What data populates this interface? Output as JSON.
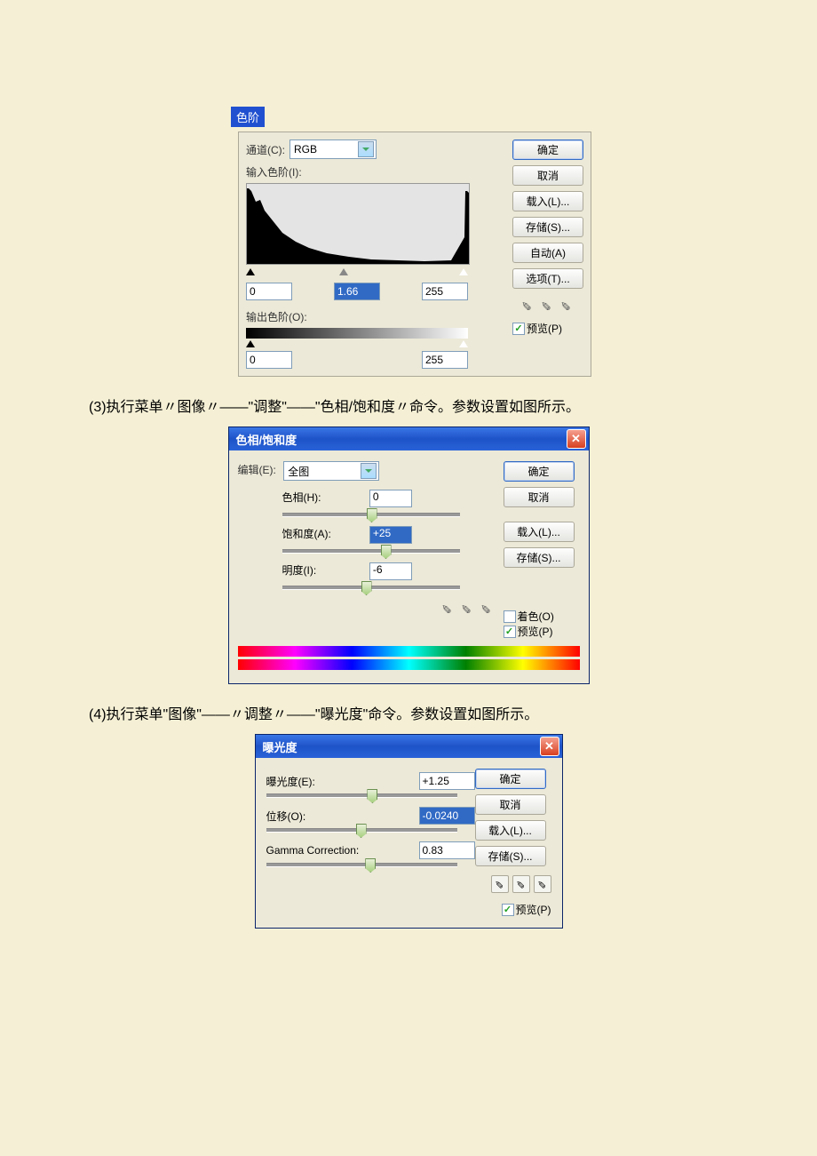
{
  "levels": {
    "title": "色阶",
    "channel_label": "通道(C):",
    "channel_value": "RGB",
    "input_label": "输入色阶(I):",
    "output_label": "输出色阶(O):",
    "in_low": "0",
    "in_mid": "1.66",
    "in_high": "255",
    "out_low": "0",
    "out_high": "255",
    "buttons": {
      "ok": "确定",
      "cancel": "取消",
      "load": "载入(L)...",
      "save": "存储(S)...",
      "auto": "自动(A)",
      "options": "选项(T)..."
    },
    "preview_label": "预览(P)"
  },
  "instruction3": "(3)执行菜单〃图像〃——\"调整\"——\"色相/饱和度〃命令。参数设置如图所示。",
  "huesat": {
    "title": "色相/饱和度",
    "edit_label": "编辑(E):",
    "edit_value": "全图",
    "hue_label": "色相(H):",
    "hue_value": "0",
    "sat_label": "饱和度(A):",
    "sat_value": "+25",
    "light_label": "明度(I):",
    "light_value": "-6",
    "buttons": {
      "ok": "确定",
      "cancel": "取消",
      "load": "载入(L)...",
      "save": "存储(S)..."
    },
    "colorize_label": "着色(O)",
    "preview_label": "预览(P)"
  },
  "instruction4": "(4)执行菜单\"图像\"——〃调整〃——\"曝光度\"命令。参数设置如图所示。",
  "exposure": {
    "title": "曝光度",
    "exposure_label": "曝光度(E):",
    "exposure_value": "+1.25",
    "offset_label": "位移(O):",
    "offset_value": "-0.0240",
    "gamma_label": "Gamma Correction:",
    "gamma_value": "0.83",
    "buttons": {
      "ok": "确定",
      "cancel": "取消",
      "load": "载入(L)...",
      "save": "存储(S)..."
    },
    "preview_label": "预览(P)"
  }
}
